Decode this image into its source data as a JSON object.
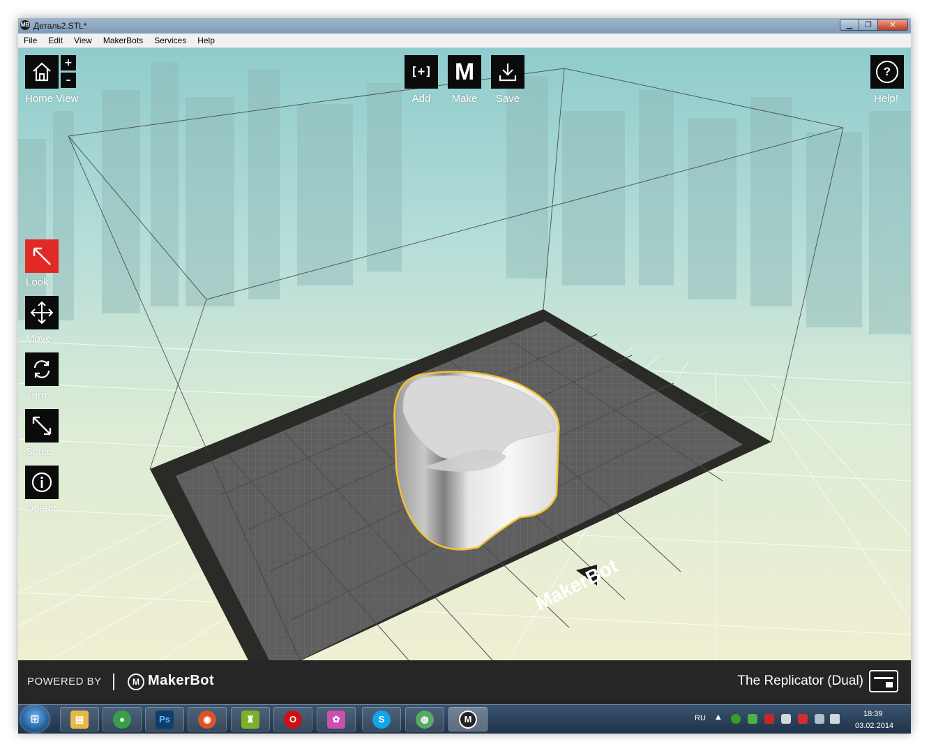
{
  "window": {
    "title": "Деталь2.STL*",
    "app_icon": "MB"
  },
  "menu": [
    "File",
    "Edit",
    "View",
    "MakerBots",
    "Services",
    "Help"
  ],
  "top_toolbar": {
    "home_label": "Home View",
    "zoom_in": "+",
    "zoom_out": "–",
    "add_label": "Add",
    "add_glyph": "[+]",
    "make_label": "Make",
    "make_glyph": "M",
    "save_label": "Save",
    "help_label": "Help!",
    "help_glyph": "?"
  },
  "side_tools": [
    {
      "label": "Look",
      "icon": "look-arrow-icon",
      "active": true
    },
    {
      "label": "Move",
      "icon": "move-arrows-icon",
      "active": false
    },
    {
      "label": "Turn",
      "icon": "rotate-icon",
      "active": false
    },
    {
      "label": "Scale",
      "icon": "scale-icon",
      "active": false
    },
    {
      "label": "Object",
      "icon": "info-icon",
      "active": false
    }
  ],
  "build_plate": {
    "brand": "MakerBot",
    "selected_model_outline": "#f2c12e",
    "active_tool_color": "#e12a25"
  },
  "footer": {
    "powered_by": "POWERED BY",
    "brand": "MakerBot",
    "logo_glyph": "M",
    "printer": "The Replicator (Dual)"
  },
  "taskbar": {
    "start_glyph": "⊞",
    "apps": [
      {
        "name": "explorer",
        "glyph": "▤",
        "color": "#e8b84a"
      },
      {
        "name": "chrome",
        "glyph": "●",
        "color": "#3a9d4a"
      },
      {
        "name": "photoshop",
        "glyph": "Ps",
        "color": "#0f3d6e"
      },
      {
        "name": "firefox",
        "glyph": "◉",
        "color": "#d9532b"
      },
      {
        "name": "app5",
        "glyph": "♜",
        "color": "#7ab02a"
      },
      {
        "name": "opera",
        "glyph": "O",
        "color": "#cc1111"
      },
      {
        "name": "picasa",
        "glyph": "✿",
        "color": "#c94fb0"
      },
      {
        "name": "skype",
        "glyph": "S",
        "color": "#12a5e8"
      },
      {
        "name": "app9",
        "glyph": "◍",
        "color": "#5aa86a"
      },
      {
        "name": "makerbot",
        "glyph": "M",
        "color": "#222222"
      }
    ],
    "lang": "RU",
    "up_arrow": "▲",
    "time": "18:39",
    "date": "03.02.2014"
  }
}
